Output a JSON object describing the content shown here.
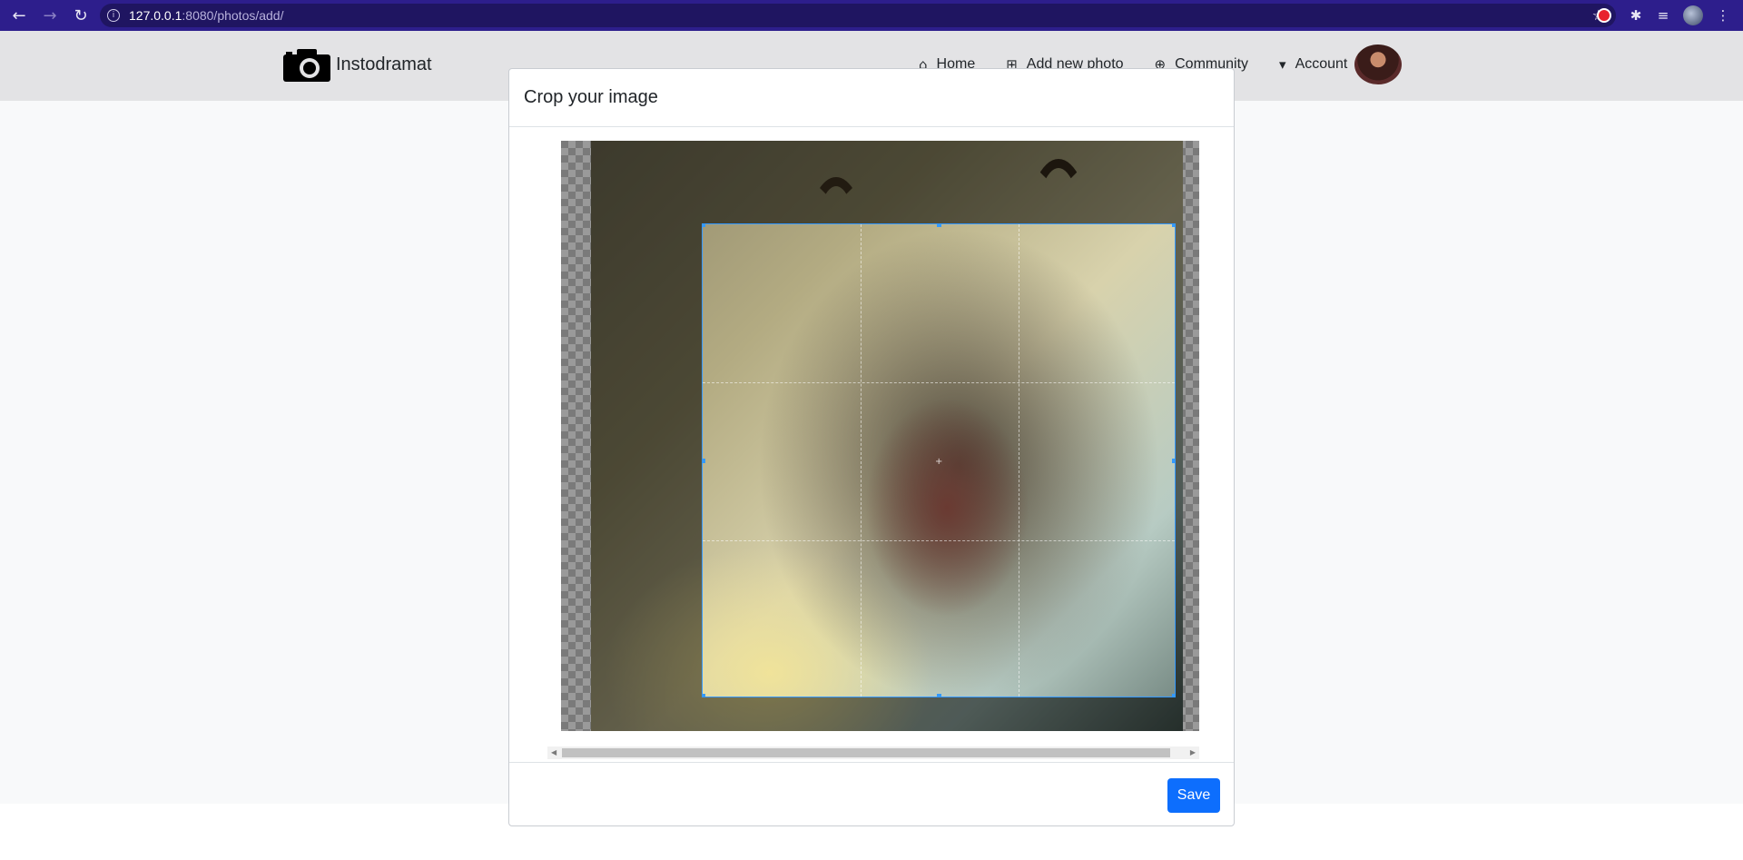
{
  "browser": {
    "url_host": "127.0.0.1",
    "url_path": ":8080/photos/add/",
    "back_icon": "back-arrow-icon",
    "forward_icon": "forward-arrow-icon",
    "reload_icon": "reload-icon"
  },
  "navbar": {
    "brand": "Instodramat",
    "links": [
      {
        "label": "Home",
        "icon": "home-icon"
      },
      {
        "label": "Add new photo",
        "icon": "plus-square-icon"
      },
      {
        "label": "Community",
        "icon": "globe-icon"
      },
      {
        "label": "Account",
        "icon": "caret-down-square-icon"
      }
    ]
  },
  "modal": {
    "title": "Crop your image",
    "save_label": "Save"
  },
  "colors": {
    "chrome": "#2d1e8c",
    "navbar": "#e3e3e5",
    "crop_border": "#3399ff",
    "primary": "#0d6efd"
  }
}
